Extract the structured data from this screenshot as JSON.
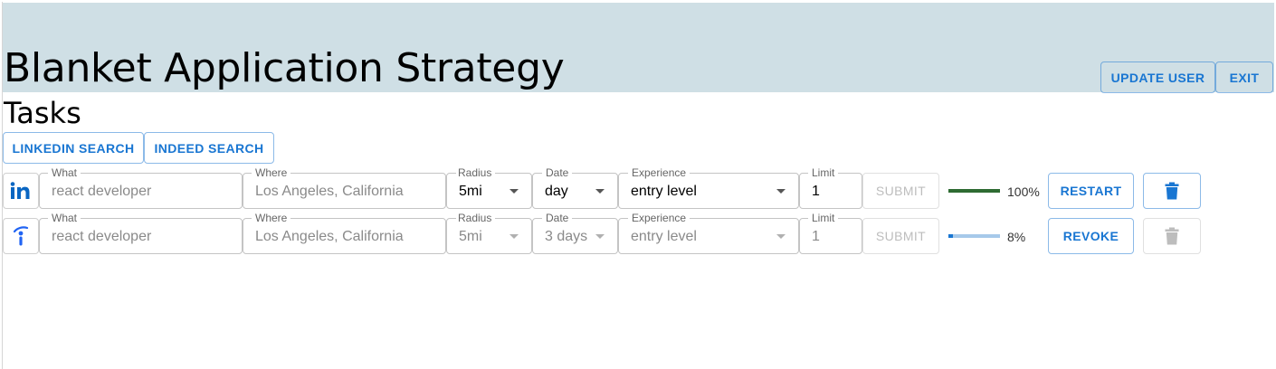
{
  "header": {
    "title": "Blanket Application Strategy",
    "update_user_label": "UPDATE USER",
    "exit_label": "EXIT",
    "banner_color": "#cfdfe5"
  },
  "tasks": {
    "title": "Tasks",
    "linkedin_search_label": "LINKEDIN SEARCH",
    "indeed_search_label": "INDEED SEARCH"
  },
  "rows": [
    {
      "source_icon": "linkedin-icon",
      "what_label": "What",
      "what_value": "react developer",
      "where_label": "Where",
      "where_value": "Los Angeles, California",
      "radius_label": "Radius",
      "radius_value": "5mi",
      "date_label": "Date",
      "date_value": "day",
      "experience_label": "Experience",
      "experience_value": "entry level",
      "limit_label": "Limit",
      "limit_value": "1",
      "submit_label": "SUBMIT",
      "progress": 1.0,
      "progress_text": "100%",
      "progress_color": "#2e6b32",
      "action_label": "RESTART",
      "delete_icon": "trash-icon"
    },
    {
      "source_icon": "indeed-icon",
      "what_label": "What",
      "what_value": "react developer",
      "where_label": "Where",
      "where_value": "Los Angeles, California",
      "radius_label": "Radius",
      "radius_value": "5mi",
      "date_label": "Date",
      "date_value": "3 days",
      "experience_label": "Experience",
      "experience_value": "entry level",
      "limit_label": "Limit",
      "limit_value": "1",
      "submit_label": "SUBMIT",
      "progress": 0.08,
      "progress_text": "8%",
      "progress_color": "#1976d2",
      "action_label": "REVOKE",
      "delete_icon": "trash-icon"
    }
  ],
  "colors": {
    "accent": "#1976d2",
    "linkedin_blue": "#0a66c2"
  }
}
